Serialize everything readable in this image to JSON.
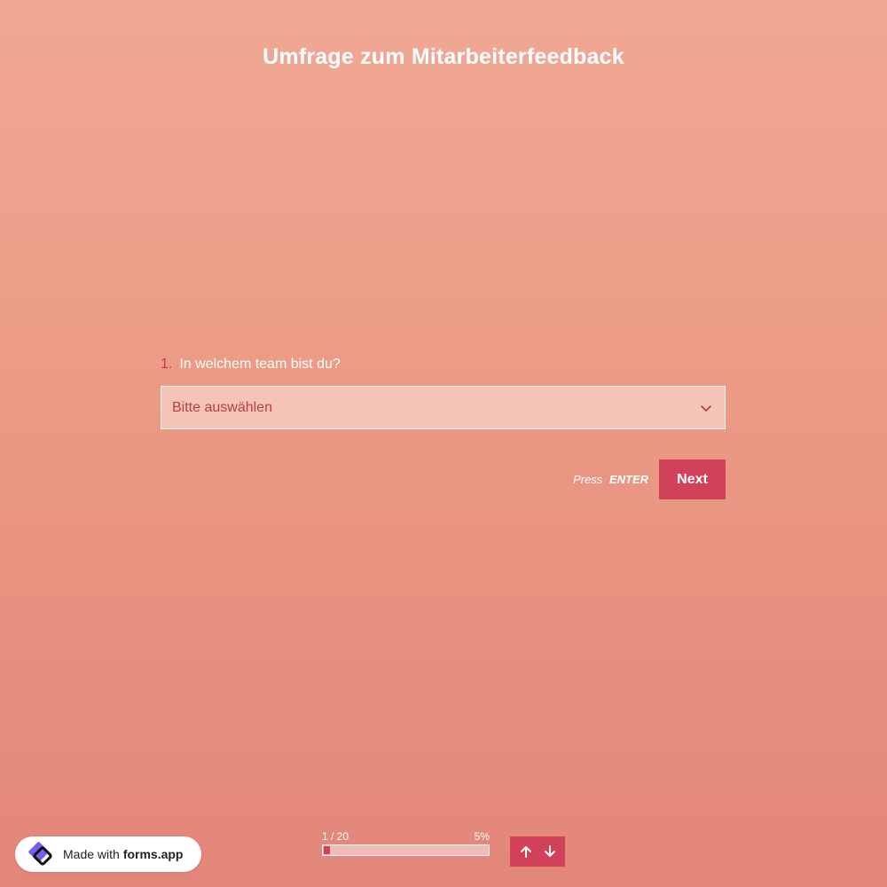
{
  "form": {
    "title": "Umfrage zum Mitarbeiterfeedback"
  },
  "question": {
    "number": "1.",
    "label": "In welchem team bist du?",
    "select_value": "Bitte auswählen",
    "select_icon": "chevron-down-icon"
  },
  "actions": {
    "hint_prefix": "Press",
    "hint_key": "ENTER",
    "next_label": "Next"
  },
  "badge": {
    "prefix": "Made with",
    "brand": "forms.app",
    "logo_icon": "forms-app-logo-icon"
  },
  "progress": {
    "step_text": "1 / 20",
    "percent_text": "5%",
    "fraction": 0.05
  },
  "nav": {
    "up_icon": "arrow-up-icon",
    "down_icon": "arrow-down-icon"
  },
  "colors": {
    "accent": "#d2415a",
    "question_number": "#c8384c",
    "select_text": "#b53d4b",
    "background_top": "#f0a894",
    "background_bottom": "#e2867a"
  }
}
